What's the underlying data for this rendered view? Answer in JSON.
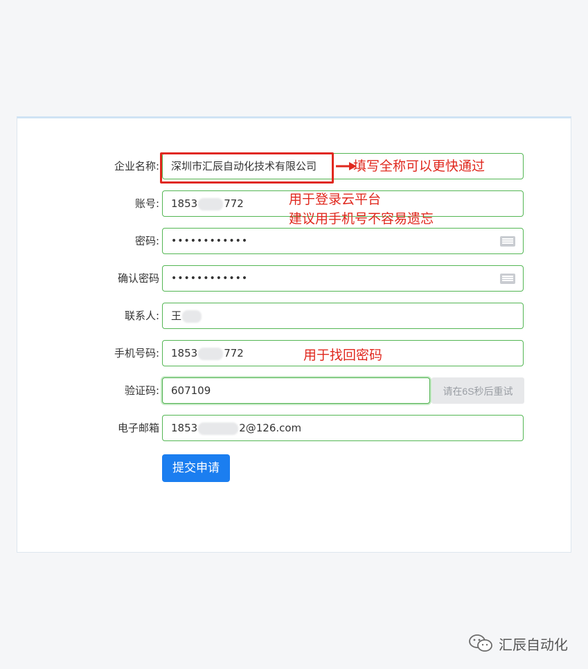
{
  "form": {
    "company": {
      "label": "企业名称:",
      "value": "深圳市汇辰自动化技术有限公司"
    },
    "account": {
      "label": "账号:",
      "value_prefix": "1853",
      "value_suffix": "772"
    },
    "password": {
      "label": "密码:",
      "value": "••••••••••••"
    },
    "confirm_password": {
      "label": "确认密码",
      "value": "••••••••••••"
    },
    "contact": {
      "label": "联系人:",
      "value_prefix": "王"
    },
    "phone": {
      "label": "手机号码:",
      "value_prefix": "1853",
      "value_suffix": "772"
    },
    "captcha": {
      "label": "验证码:",
      "value": "607109",
      "button_label": "请在6S秒后重试"
    },
    "email": {
      "label": "电子邮箱",
      "value_prefix": "1853",
      "value_suffix": "2@126.com"
    },
    "submit_label": "提交申请"
  },
  "annotations": {
    "company_note": "填写全称可以更快通过",
    "account_note_line1": "用于登录云平台",
    "account_note_line2": "建议用手机号不容易遗忘",
    "phone_note": "用于找回密码"
  },
  "watermark": {
    "text": "汇辰自动化",
    "icon": "wechat-icon"
  },
  "colors": {
    "accent_blue": "#1b7ef0",
    "field_border_green": "#53b653",
    "annotation_red": "#e0281e",
    "page_background": "#f5f6f8"
  }
}
